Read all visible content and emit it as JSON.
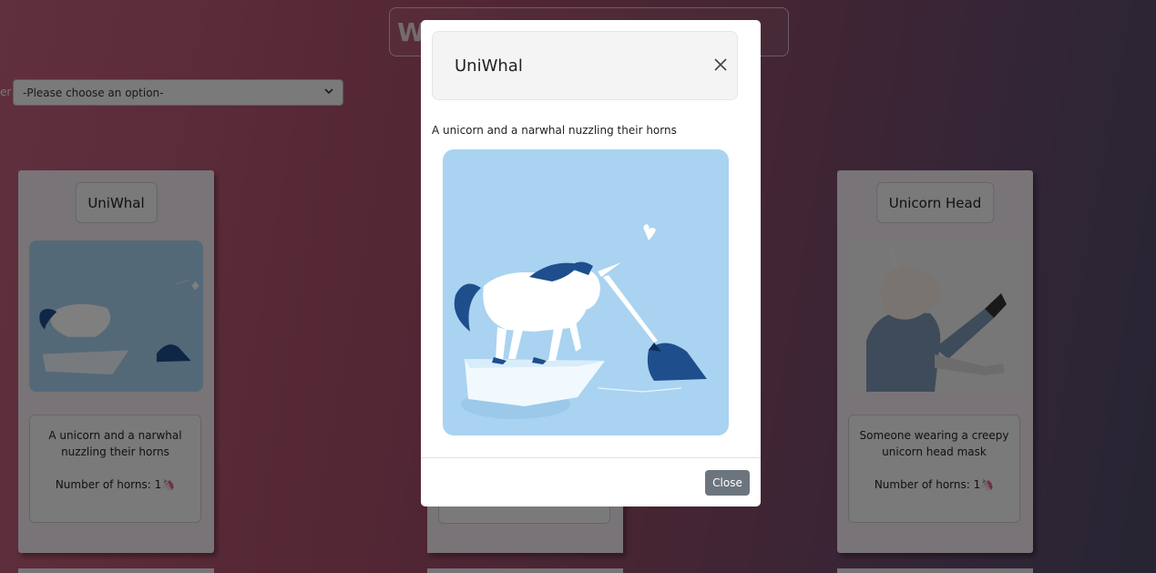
{
  "page": {
    "title_visible": "W                                                                   ld",
    "filter_label": "er",
    "filter_select_value": "-Please choose an option-"
  },
  "cards": [
    {
      "title": "UniWhal",
      "description": "A unicorn and a narwhal nuzzling their horns",
      "horns_text": "Number of horns: 1🦄"
    },
    {
      "title": "Unicorn Head",
      "description": "Someone wearing a creepy unicorn head mask",
      "horns_text": "Number of horns: 1🦄"
    }
  ],
  "modal": {
    "title": "UniWhal",
    "description": "A unicorn and a narwhal nuzzling their horns",
    "close_label": "Close"
  },
  "colors": {
    "modal_image_bg": "#a9d3f0",
    "close_button": "#6c757d"
  }
}
